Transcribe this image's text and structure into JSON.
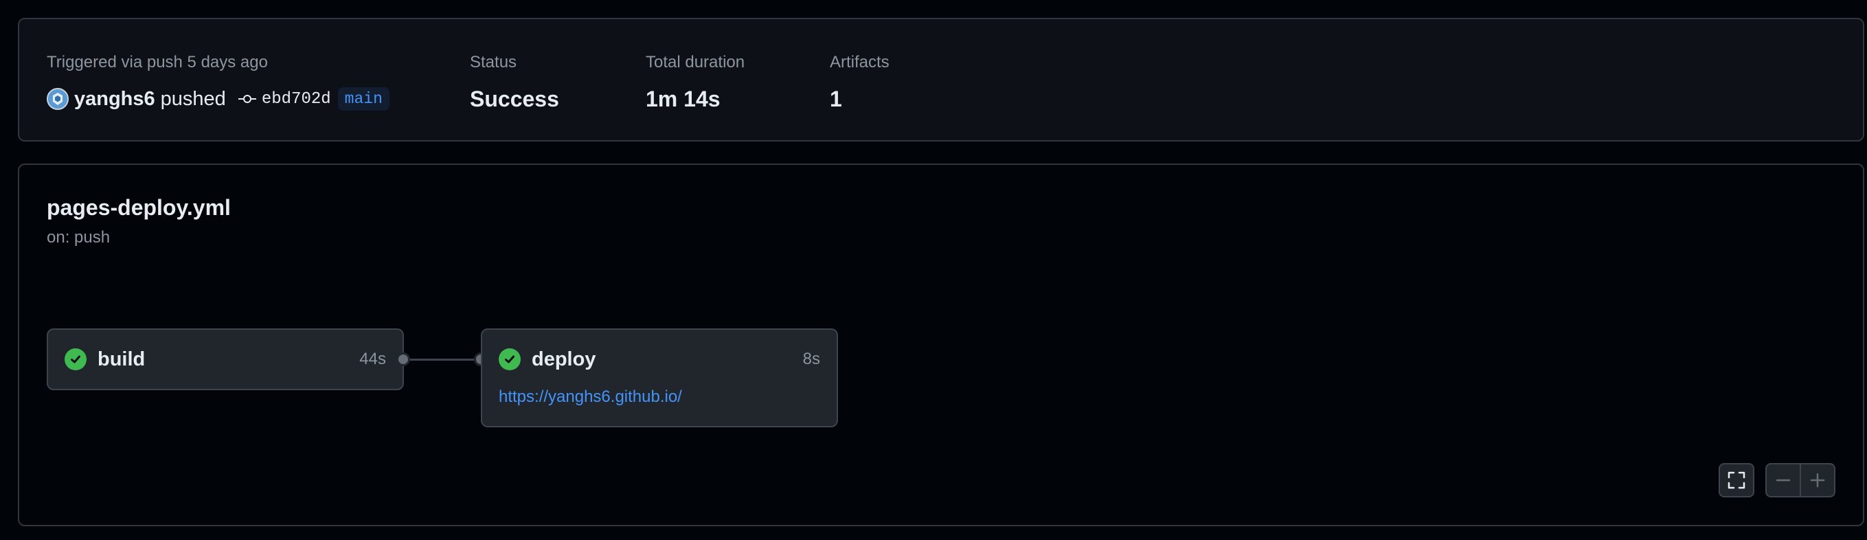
{
  "summary": {
    "trigger_label": "Triggered via push 5 days ago",
    "actor": "yanghs6",
    "action": "pushed",
    "commit_sha": "ebd702d",
    "branch": "main",
    "status_label": "Status",
    "status_value": "Success",
    "duration_label": "Total duration",
    "duration_value": "1m 14s",
    "artifacts_label": "Artifacts",
    "artifacts_value": "1"
  },
  "workflow": {
    "file": "pages-deploy.yml",
    "trigger": "on: push",
    "jobs": [
      {
        "name": "build",
        "duration": "44s",
        "status": "success"
      },
      {
        "name": "deploy",
        "duration": "8s",
        "status": "success",
        "url": "https://yanghs6.github.io/"
      }
    ]
  },
  "colors": {
    "success": "#3fb950",
    "link": "#4493f8",
    "background": "#010409",
    "panel": "#0d1117",
    "border": "#30363d"
  },
  "icons": [
    "user-avatar",
    "git-commit-icon",
    "check-circle-icon",
    "fullscreen-icon",
    "zoom-out-icon",
    "zoom-in-icon"
  ]
}
